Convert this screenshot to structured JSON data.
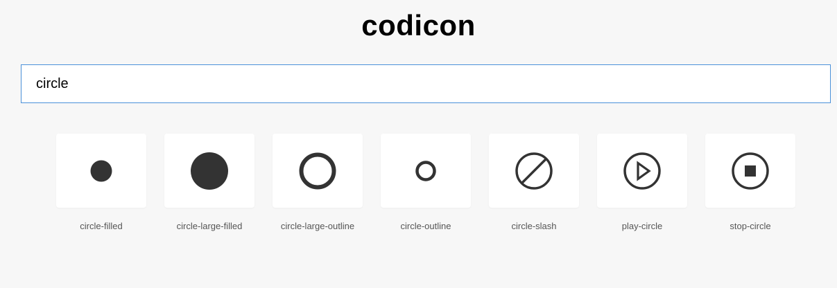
{
  "header": {
    "title": "codicon"
  },
  "search": {
    "value": "circle",
    "placeholder": ""
  },
  "colors": {
    "icon": "#333333",
    "accent_border": "#4a90d9",
    "background": "#f7f7f7",
    "card": "#ffffff",
    "label": "#555555"
  },
  "results": [
    {
      "icon": "circle-filled-icon",
      "label": "circle-filled"
    },
    {
      "icon": "circle-large-filled-icon",
      "label": "circle-large-filled"
    },
    {
      "icon": "circle-large-outline-icon",
      "label": "circle-large-outline"
    },
    {
      "icon": "circle-outline-icon",
      "label": "circle-outline"
    },
    {
      "icon": "circle-slash-icon",
      "label": "circle-slash"
    },
    {
      "icon": "play-circle-icon",
      "label": "play-circle"
    },
    {
      "icon": "stop-circle-icon",
      "label": "stop-circle"
    }
  ]
}
